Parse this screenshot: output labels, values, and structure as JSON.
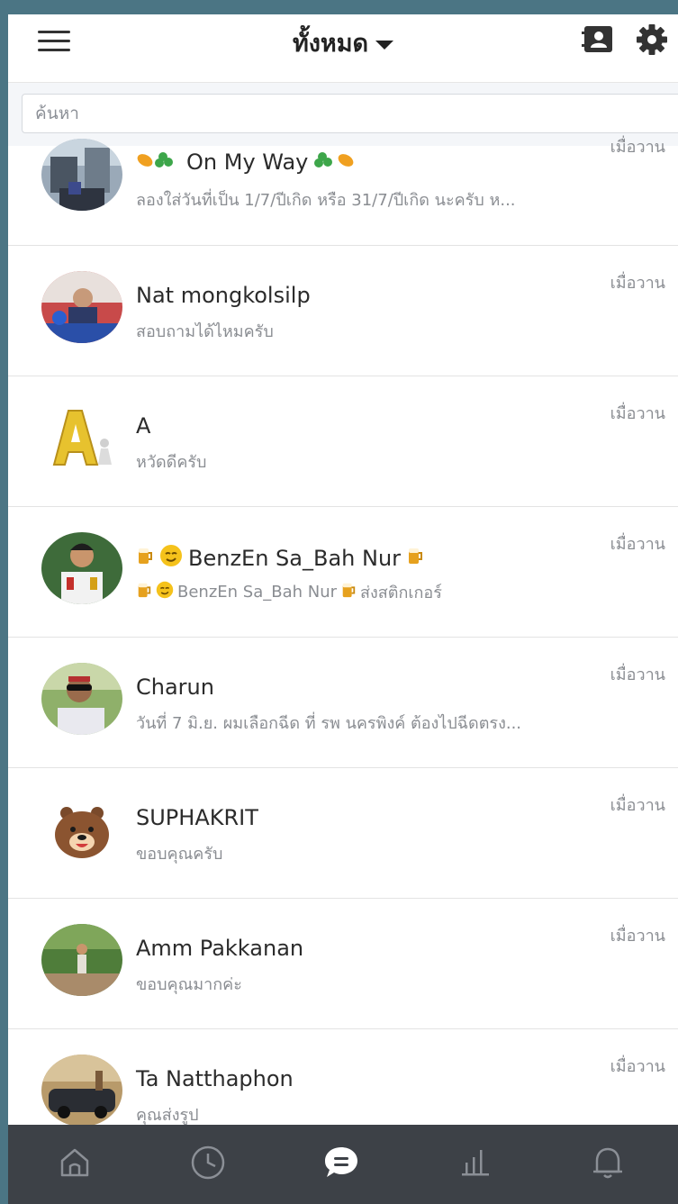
{
  "header": {
    "title": "ทั้งหมด",
    "menu_icon": "hamburger-menu-icon",
    "contacts_icon": "contacts-book-icon",
    "settings_icon": "gear-icon"
  },
  "search": {
    "placeholder": "ค้นหา",
    "value": ""
  },
  "chats": [
    {
      "name": "On My Way",
      "message": "ลองใส่วันที่เป็น 1/7/ปีเกิด หรือ 31/7/ปีเกิด นะครับ ห...",
      "time": "เมื่อวาน",
      "avatar": "city-balcony-photo"
    },
    {
      "name": "Nat mongkolsilp",
      "message": "สอบถามได้ไหมครับ",
      "time": "เมื่อวาน",
      "avatar": "man-photo-badge"
    },
    {
      "name": "A",
      "message": "หวัดดีครับ",
      "time": "เมื่อวาน",
      "avatar": "gold-letter-a"
    },
    {
      "name": "BenzEn Sa_Bah Nur",
      "message": "BenzEn Sa_Bah Nur",
      "message_suffix": "ส่งสติกเกอร์",
      "time": "เมื่อวาน",
      "avatar": "uniform-portrait"
    },
    {
      "name": "Charun",
      "message": "วันที่ 7 มิ.ย. ผมเลือกฉีด ที่ รพ นครพิงค์ ต้องไปฉีดตรง...",
      "time": "เมื่อวาน",
      "avatar": "man-sunglasses-photo"
    },
    {
      "name": "SUPHAKRIT",
      "message": "ขอบคุณครับ",
      "time": "เมื่อวาน",
      "avatar": "cartoon-bear"
    },
    {
      "name": "Amm Pakkanan",
      "message": "ขอบคุณมากค่ะ",
      "time": "เมื่อวาน",
      "avatar": "garden-photo"
    },
    {
      "name": "Ta Natthaphon",
      "message": "คุณส่งรูป",
      "time": "เมื่อวาน",
      "avatar": "car-photo"
    }
  ],
  "nav": [
    {
      "icon": "home-icon",
      "active": false
    },
    {
      "icon": "clock-icon",
      "active": false
    },
    {
      "icon": "chat-icon",
      "active": true
    },
    {
      "icon": "stats-icon",
      "active": false
    },
    {
      "icon": "bell-icon",
      "active": false
    }
  ],
  "colors": {
    "frame": "#4b7584",
    "nav_bg": "#3d4147",
    "nav_icon": "#8b8f96",
    "nav_active": "#ffffff",
    "muted_text": "#8a8d92"
  }
}
